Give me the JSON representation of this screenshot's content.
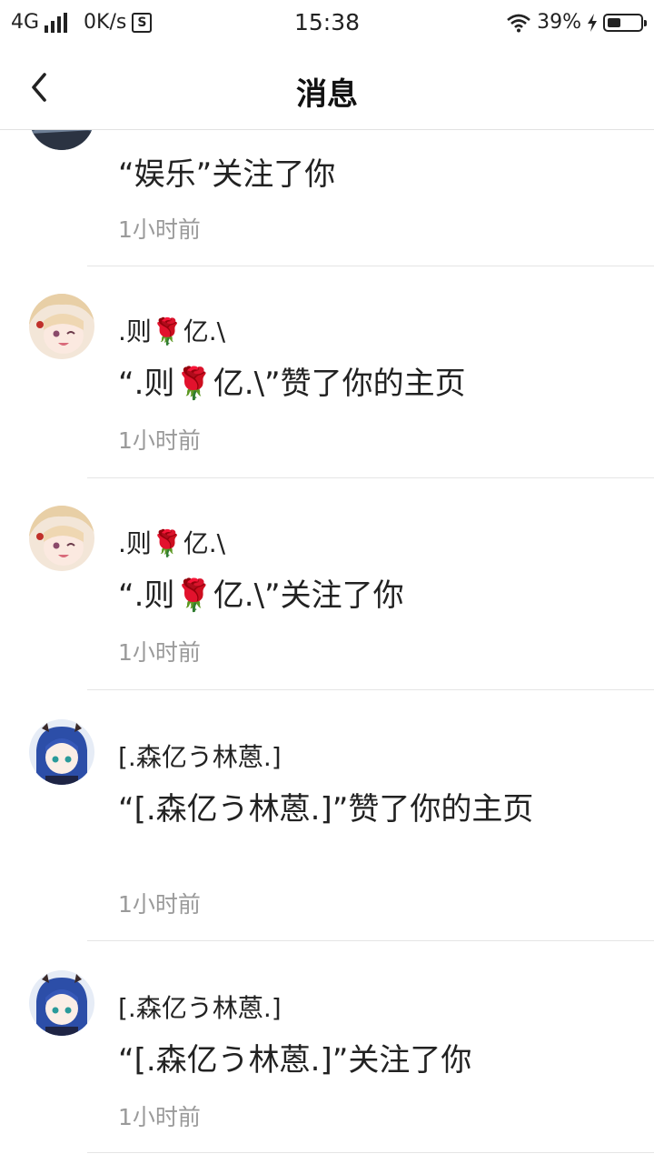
{
  "status_bar": {
    "network": "4G",
    "speed": "0K/s",
    "s_icon": "S",
    "time": "15:38",
    "battery": "39%",
    "icons": [
      "signal-icon",
      "wifi-icon",
      "charging-icon",
      "battery-icon"
    ]
  },
  "header": {
    "title": "消息",
    "back_icon": "chevron-left-icon"
  },
  "notifications": [
    {
      "name": "",
      "message": "“娱乐”关注了你",
      "time": "1小时前"
    },
    {
      "name": ".则🌹亿.\\",
      "message": "“.则🌹亿.\\”赞了你的主页",
      "time": "1小时前"
    },
    {
      "name": ".则🌹亿.\\",
      "message": "“.则🌹亿.\\”关注了你",
      "time": "1小时前"
    },
    {
      "name": "[.森亿う林蒽.]",
      "message": "“[.森亿う林蒽.]”赞了你的主页",
      "time": "1小时前"
    },
    {
      "name": "[.森亿う林蒽.]",
      "message": "“[.森亿う林蒽.]”关注了你",
      "time": "1小时前"
    }
  ]
}
